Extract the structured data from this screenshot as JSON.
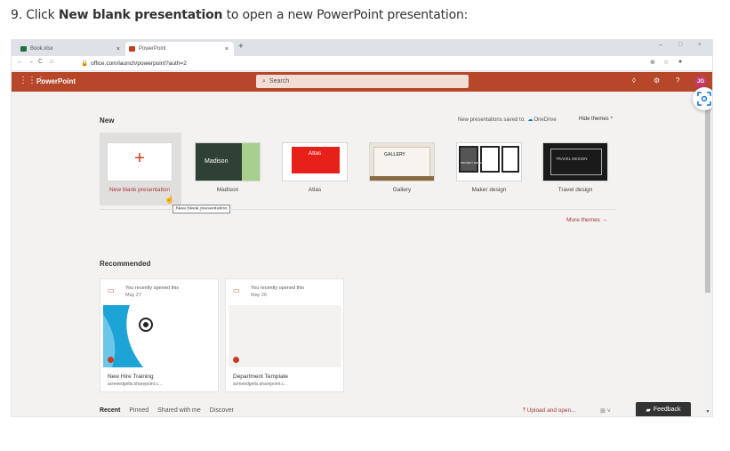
{
  "instruction": {
    "prefix": "9. Click ",
    "bold": "New blank presentation",
    "suffix": " to open a new PowerPoint presentation:"
  },
  "browser": {
    "tabs": [
      {
        "label": "Book.xlsx",
        "close": "×",
        "active": false,
        "color": "#1d6f42"
      },
      {
        "label": "PowerPoint",
        "close": "×",
        "active": true,
        "color": "#c43e1c"
      }
    ],
    "new_tab": "+",
    "window_controls": [
      "–",
      "□",
      "×"
    ],
    "nav": [
      "←",
      "→",
      "C",
      "⌂"
    ],
    "url": "office.com/launch/powerpoint?auth=2",
    "lock": "🔒",
    "right_icons": [
      "⊕",
      "☆",
      "●"
    ]
  },
  "app": {
    "waffle": "⋮⋮⋮",
    "name": "PowerPoint",
    "search_icon": "⌕",
    "search_placeholder": "Search",
    "header_icons": [
      "◊",
      "⚙",
      "?"
    ],
    "avatar": "JG",
    "brand_color": "#b7472a"
  },
  "new_section": {
    "title": "New",
    "saved_prefix": "New presentations saved to:",
    "saved_icon": "☁",
    "saved_target": "OneDrive",
    "hide_themes": "Hide themes",
    "hide_chevron": "^",
    "templates": [
      {
        "label": "New blank presentation",
        "thumb_text": "+"
      },
      {
        "label": "Madison",
        "thumb_text": "Madison"
      },
      {
        "label": "Atlas",
        "thumb_text": "Atlas"
      },
      {
        "label": "Gallery",
        "thumb_text": "GALLERY"
      },
      {
        "label": "Maker design",
        "thumb_text": "PROJECT DESIGN"
      },
      {
        "label": "Travel design",
        "thumb_text": "TRAVEL DESIGN"
      }
    ],
    "tooltip": "New blank presentation",
    "more_themes": "More themes",
    "more_arrow": "→"
  },
  "recommended": {
    "title": "Recommended",
    "cards": [
      {
        "opened": "You recently opened this",
        "date": "May 27",
        "name": "New Hire Training",
        "location": "acmeedgelts.sharepoint.c..."
      },
      {
        "opened": "You recently opened this",
        "date": "May 26",
        "name": "Department Template",
        "location": "acmeedgelts.sharepoint.c..."
      }
    ]
  },
  "bottom": {
    "tabs": [
      "Recent",
      "Pinned",
      "Shared with me",
      "Discover"
    ],
    "upload_icon": "⤒",
    "upload": "Upload and open...",
    "view_toggle": "⊞ ˅",
    "feedback_icon": "▰",
    "feedback": "Feedback"
  }
}
